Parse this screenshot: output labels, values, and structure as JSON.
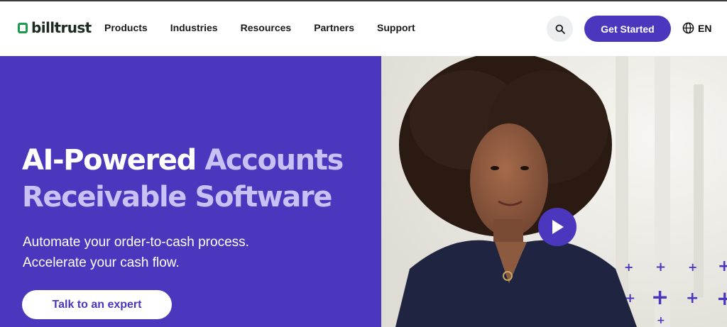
{
  "header": {
    "logo_text": "billtrust",
    "nav": [
      "Products",
      "Industries",
      "Resources",
      "Partners",
      "Support"
    ],
    "cta_label": "Get Started",
    "language": "EN"
  },
  "hero": {
    "headline_part1": "AI-Powered ",
    "headline_part2": "Accounts Receivable Software",
    "subline1": "Automate your order-to-cash process.",
    "subline2": "Accelerate your cash flow.",
    "button_label": "Talk to an expert"
  },
  "colors": {
    "brand_purple": "#4b37be",
    "accent_lavender": "#c9c0f4",
    "logo_green": "#1a9c4a"
  },
  "icons": [
    "logo-mark-icon",
    "search-icon",
    "globe-icon",
    "play-icon",
    "plus-icon"
  ]
}
